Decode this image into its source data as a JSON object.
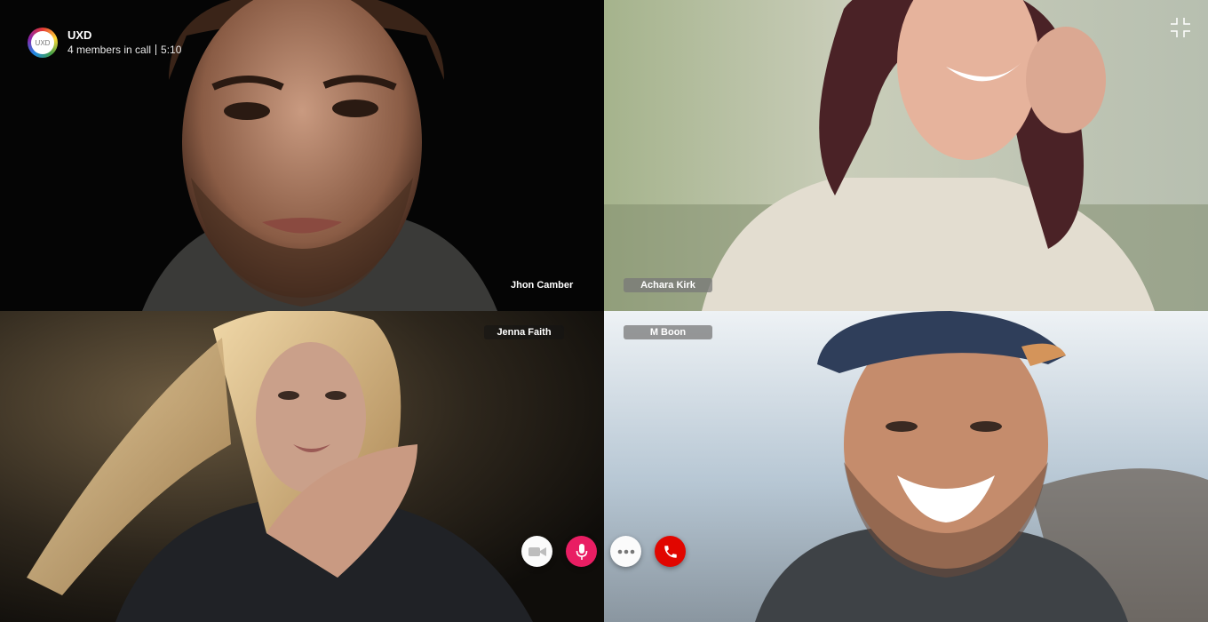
{
  "header": {
    "group_name": "UXD",
    "logo_text": "UXD",
    "members": "4 members in call",
    "duration": "5:10"
  },
  "participants": [
    {
      "name": "Jhon Camber"
    },
    {
      "name": "Achara Kirk"
    },
    {
      "name": "Jenna Faith"
    },
    {
      "name": "M Boon"
    }
  ],
  "controls": {
    "camera_icon": "video-camera-icon",
    "mic_icon": "microphone-icon",
    "more_icon": "more-dots-icon",
    "end_icon": "phone-icon"
  },
  "colors": {
    "mic_active": "#e91e63",
    "end_call": "#e10600",
    "control_bg": "#fbfbfb"
  }
}
